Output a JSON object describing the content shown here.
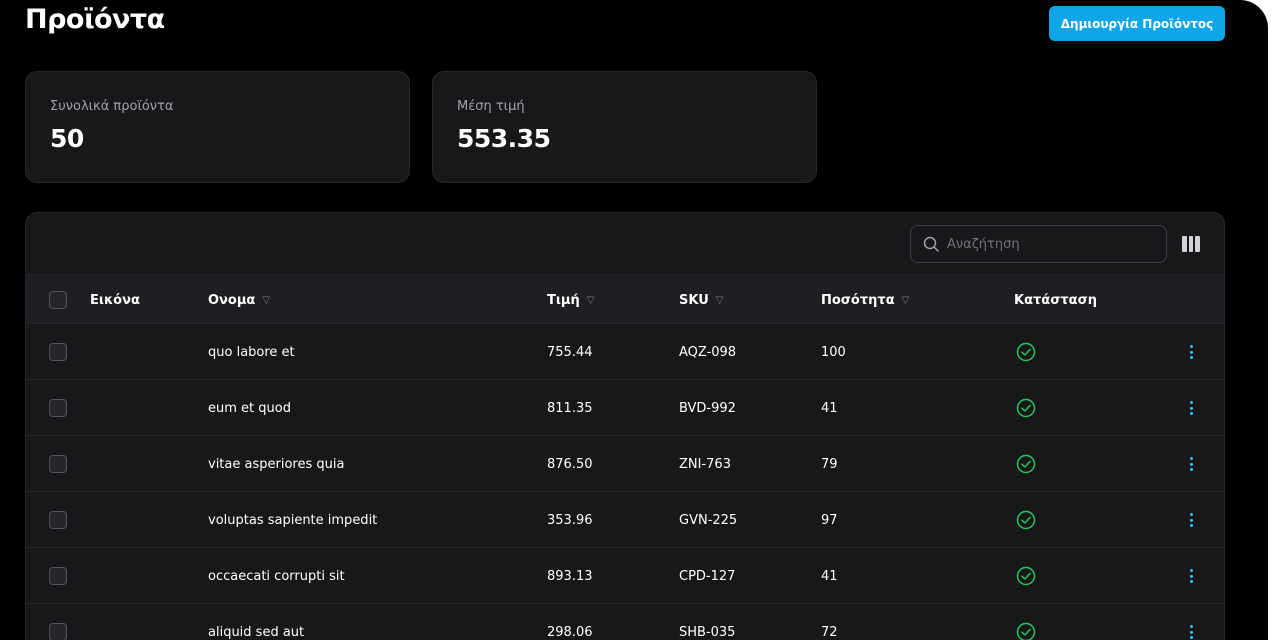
{
  "header": {
    "title": "Προϊόντα",
    "create_button": "Δημιουργία Προϊόντος"
  },
  "stats": [
    {
      "label": "Συνολικά προϊόντα",
      "value": "50"
    },
    {
      "label": "Μέση τιμή",
      "value": "553.35"
    }
  ],
  "table": {
    "search_placeholder": "Αναζήτηση",
    "columns": {
      "image": "Εικόνα",
      "name": "Ονομα",
      "price": "Τιμή",
      "sku": "SKU",
      "quantity": "Ποσότητα",
      "status": "Κατάσταση"
    },
    "rows": [
      {
        "name": "quo labore et",
        "price": "755.44",
        "sku": "AQZ-098",
        "quantity": "100",
        "status": "check-circle-icon"
      },
      {
        "name": "eum et quod",
        "price": "811.35",
        "sku": "BVD-992",
        "quantity": "41",
        "status": "check-circle-icon"
      },
      {
        "name": "vitae asperiores quia",
        "price": "876.50",
        "sku": "ZNI-763",
        "quantity": "79",
        "status": "check-circle-icon"
      },
      {
        "name": "voluptas sapiente impedit",
        "price": "353.96",
        "sku": "GVN-225",
        "quantity": "97",
        "status": "check-circle-icon"
      },
      {
        "name": "occaecati corrupti sit",
        "price": "893.13",
        "sku": "CPD-127",
        "quantity": "41",
        "status": "check-circle-icon"
      },
      {
        "name": "aliquid sed aut",
        "price": "298.06",
        "sku": "SHB-035",
        "quantity": "72",
        "status": "check-circle-icon"
      }
    ]
  },
  "colors": {
    "accent": "#0ea5e9",
    "status_ok": "#22c55e",
    "background": "#000000",
    "card": "#18181b"
  }
}
